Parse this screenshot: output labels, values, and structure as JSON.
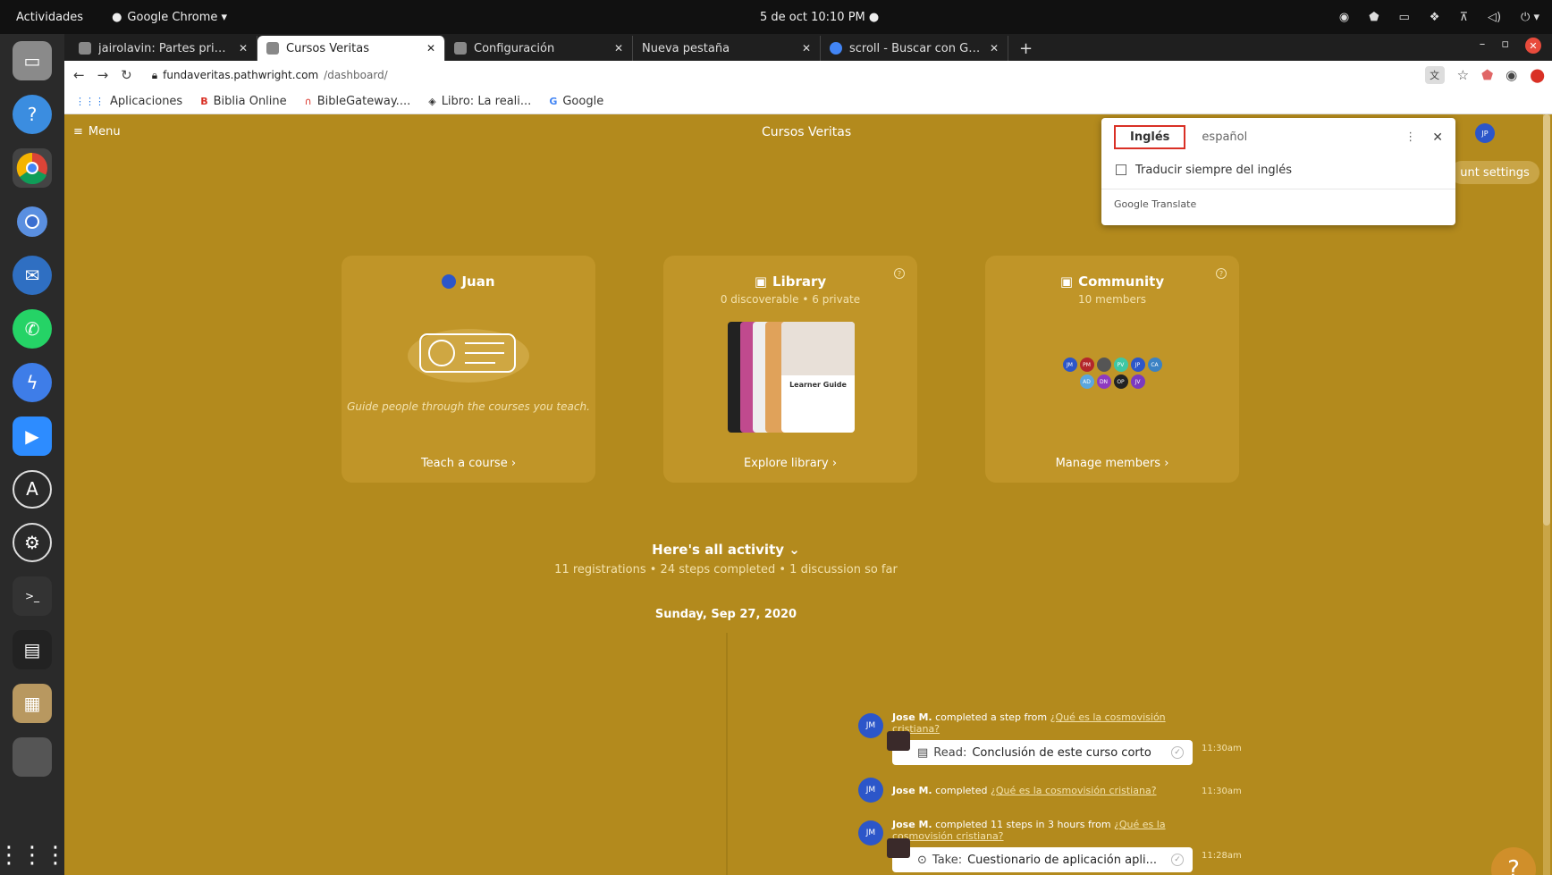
{
  "topbar": {
    "activities": "Actividades",
    "app_name": "Google Chrome ▾",
    "clock": "5 de oct  10:10 PM  ●"
  },
  "tabs": [
    {
      "label": "jairolavin: Partes principa",
      "active": false
    },
    {
      "label": "Cursos Veritas",
      "active": true
    },
    {
      "label": "Configuración",
      "active": false
    },
    {
      "label": "Nueva pestaña",
      "active": false
    },
    {
      "label": "scroll - Buscar con Google",
      "active": false
    }
  ],
  "toolbar": {
    "url_domain": "fundaveritas.pathwright.com",
    "url_path": "/dashboard/"
  },
  "bookmarks": [
    {
      "label": "Aplicaciones",
      "icon": "apps-grid-icon"
    },
    {
      "label": "Biblia Online",
      "icon": "b-icon"
    },
    {
      "label": "BibleGateway....",
      "icon": "headphones-icon"
    },
    {
      "label": "Libro: La reali...",
      "icon": "book-icon"
    },
    {
      "label": "Google",
      "icon": "google-icon"
    }
  ],
  "page": {
    "menu_label": "Menu",
    "site_title": "Cursos Veritas",
    "account_settings_label": "unt settings",
    "user_initials": "JP",
    "cards": {
      "teach": {
        "title": "Juan",
        "message": "Guide people through the courses you teach.",
        "link": "Teach a course ›"
      },
      "library": {
        "title": "Library",
        "sub": "0 discoverable • 6 private",
        "cover_label": "Learner Guide",
        "link": "Explore library ›"
      },
      "community": {
        "title": "Community",
        "sub": "10 members",
        "link": "Manage members ›",
        "members": [
          {
            "initials": "JM",
            "color": "#2c56c9"
          },
          {
            "initials": "PM",
            "color": "#b3262b"
          },
          {
            "initials": "",
            "color": "#555555"
          },
          {
            "initials": "PV",
            "color": "#3fc7a4"
          },
          {
            "initials": "JP",
            "color": "#2c56c9"
          },
          {
            "initials": "CA",
            "color": "#3b82c4"
          },
          {
            "initials": "AD",
            "color": "#5aa7e0"
          },
          {
            "initials": "DN",
            "color": "#8e3ac0"
          },
          {
            "initials": "OP",
            "color": "#222222"
          },
          {
            "initials": "JV",
            "color": "#7b3ac0"
          }
        ]
      }
    },
    "activity": {
      "title": "Here's all activity",
      "summary": "11 registrations • 24 steps completed • 1 discussion so far",
      "date": "Sunday, Sep 27, 2020",
      "items": [
        {
          "initials": "JM",
          "actor": "Jose M.",
          "verb": " completed a step from ",
          "object": "¿Qué es la cosmovisión cristiana?",
          "time": "11:30am",
          "card_prefix": "Read:",
          "card_text": "Conclusión de este curso corto"
        },
        {
          "initials": "JM",
          "actor": "Jose M.",
          "verb": " completed ",
          "object": "¿Qué es la cosmovisión cristiana?",
          "time": "11:30am"
        },
        {
          "initials": "JM",
          "actor": "Jose M.",
          "verb": " completed 11 steps in 3 hours from ",
          "object": "¿Qué es la cosmovisión cristiana?",
          "time": "11:28am",
          "card_prefix": "Take:",
          "card_text": "Cuestionario de aplicación apli..."
        }
      ]
    },
    "help_label": "?"
  },
  "translate_popup": {
    "lang_active": "Inglés",
    "lang_other": "español",
    "always_translate": "Traducir siempre del inglés",
    "footer": "Google Translate"
  }
}
